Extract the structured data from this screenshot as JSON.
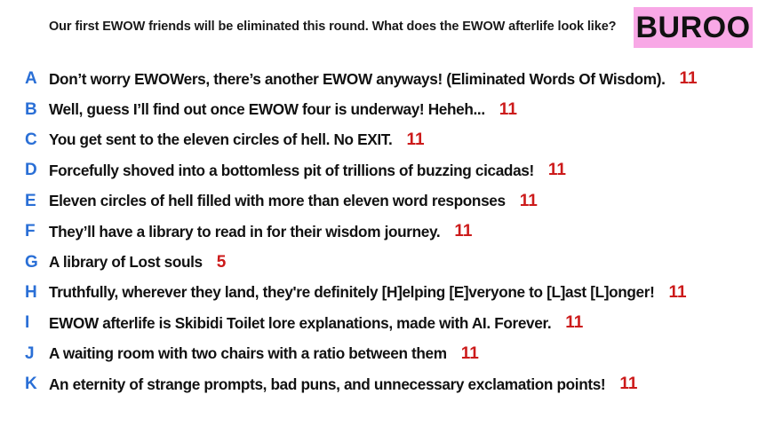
{
  "prompt": "Our first EWOW friends will be eliminated this round. What does the EWOW afterlife look like?",
  "badge": "BUROO",
  "responses": [
    {
      "letter": "A",
      "text": "Don’t worry EWOWers, there’s another EWOW anyways! (Eliminated Words Of Wisdom).",
      "score": "11"
    },
    {
      "letter": "B",
      "text": "Well, guess I’ll find out once EWOW four is underway! Heheh...",
      "score": "11"
    },
    {
      "letter": "C",
      "text": "You get sent to the eleven circles of hell. No EXIT.",
      "score": "11"
    },
    {
      "letter": "D",
      "text": "Forcefully shoved into a bottomless pit of trillions of  buzzing cicadas!",
      "score": "11"
    },
    {
      "letter": "E",
      "text": "Eleven circles of hell filled with more than eleven word responses",
      "score": "11"
    },
    {
      "letter": "F",
      "text": "They’ll have a library to read in for their wisdom journey.",
      "score": "11"
    },
    {
      "letter": "G",
      "text": "A library of Lost souls",
      "score": "5"
    },
    {
      "letter": "H",
      "text": "Truthfully, wherever they land, they're definitely [H]elping [E]veryone to [L]ast [L]onger!",
      "score": "11"
    },
    {
      "letter": "I",
      "text": "EWOW afterlife is Skibidi Toilet lore explanations, made with AI. Forever.",
      "score": "11"
    },
    {
      "letter": "J",
      "text": "A waiting room with two chairs with a ratio between them",
      "score": "11"
    },
    {
      "letter": "K",
      "text": "An eternity of strange prompts, bad puns, and unnecessary exclamation points!",
      "score": "11"
    }
  ],
  "colors": {
    "letter": "#2a6fd6",
    "score": "#cc1a1a",
    "badge_bg": "#f8a8e6"
  }
}
